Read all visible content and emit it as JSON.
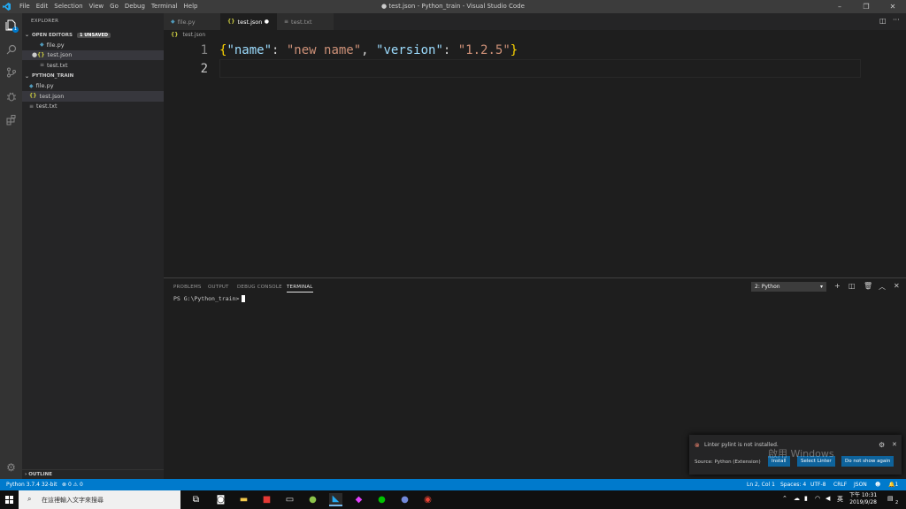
{
  "titlebar": {
    "menus": [
      "File",
      "Edit",
      "Selection",
      "View",
      "Go",
      "Debug",
      "Terminal",
      "Help"
    ],
    "title": "● test.json - Python_train - Visual Studio Code"
  },
  "sidebar": {
    "header": "EXPLORER",
    "open_editors": "OPEN EDITORS",
    "unsaved": "1 UNSAVED",
    "open_files": [
      "file.py",
      "test.json",
      "test.txt"
    ],
    "folder": "PYTHON_TRAIN",
    "files": [
      "file.py",
      "test.json",
      "test.txt"
    ],
    "outline": "OUTLINE"
  },
  "tabs": [
    "file.py",
    "test.json",
    "test.txt"
  ],
  "breadcrumb": "test.json",
  "editor": {
    "line_numbers": [
      "1",
      "2"
    ],
    "line1": {
      "p1": "{",
      "k1": "\"name\"",
      "c1": ": ",
      "v1": "\"new name\"",
      "c2": ", ",
      "k2": "\"version\"",
      "c3": ": ",
      "v2": "\"1.2.5\"",
      "p2": "}"
    }
  },
  "panel": {
    "tabs": [
      "PROBLEMS",
      "OUTPUT",
      "DEBUG CONSOLE",
      "TERMINAL"
    ],
    "select": "2: Python",
    "prompt": "PS G:\\Python_train>"
  },
  "notification": {
    "message": "Linter pylint is not installed.",
    "source": "Source: Python (Extension)",
    "buttons": [
      "Install",
      "Select Linter",
      "Do not show again"
    ]
  },
  "watermark": "啟用 Windows",
  "status": {
    "python": "Python 3.7.4 32-bit",
    "errors": "0",
    "warnings": "0",
    "position": "Ln 2, Col 1",
    "spaces": "Spaces: 4",
    "encoding": "UTF-8",
    "eol": "CRLF",
    "language": "JSON",
    "bell": "1"
  },
  "taskbar": {
    "search_placeholder": "在這裡輸入文字來搜尋",
    "lang": "英",
    "time": "下午 10:31",
    "date": "2019/9/28",
    "notif": "2"
  },
  "colors": {
    "accent": "#007acc",
    "key": "#9cdcfe",
    "string": "#ce9178",
    "bracket": "#ffd700"
  }
}
